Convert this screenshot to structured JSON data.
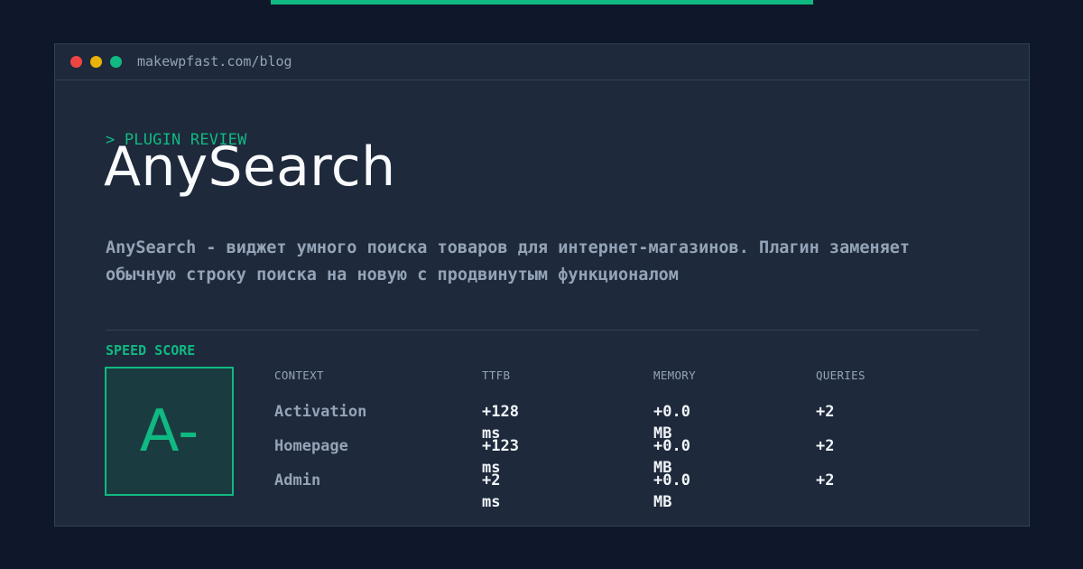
{
  "browser": {
    "url": "makewpfast.com/blog"
  },
  "header": {
    "eyebrow": "> PLUGIN REVIEW",
    "title": "AnySearch",
    "description": "AnySearch - виджет умного поиска товаров для интернет-магазинов. Плагин заменяет обычную строку поиска на новую с продвинутым функционалом"
  },
  "score": {
    "label": "SPEED SCORE",
    "grade": "A-"
  },
  "metrics": {
    "headers": [
      "CONTEXT",
      "TTFB",
      "MEMORY",
      "QUERIES"
    ],
    "rows": [
      [
        "Activation",
        "+128 ms",
        "+0.0 MB",
        "+2"
      ],
      [
        "Homepage",
        "+123 ms",
        "+0.0 MB",
        "+2"
      ],
      [
        "Admin",
        "+2 ms",
        "+0.0 MB",
        "+2"
      ]
    ]
  },
  "colors": {
    "background": "#0f172a",
    "panel": "#1e293b",
    "accent": "#10b981",
    "muted": "#94a3b8",
    "text": "#f8fafc"
  }
}
